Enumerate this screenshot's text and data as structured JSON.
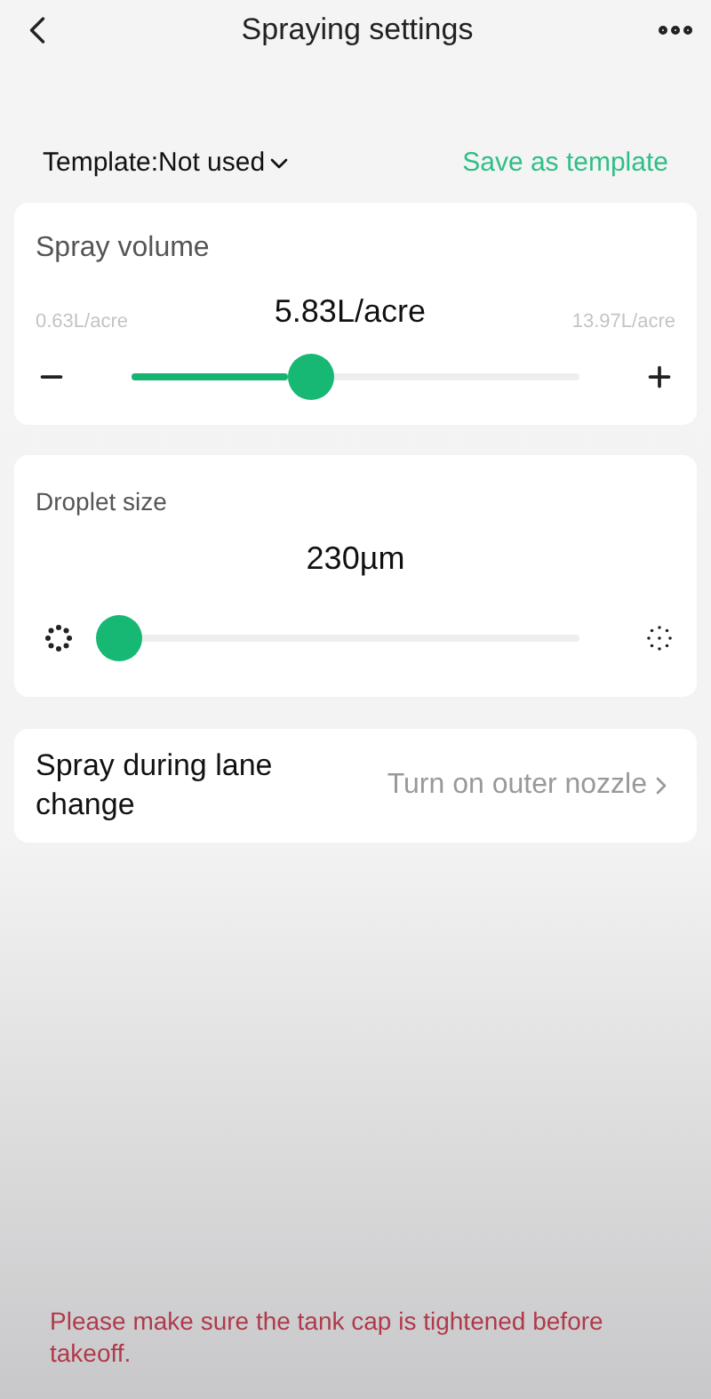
{
  "header": {
    "title": "Spraying settings"
  },
  "template": {
    "label": "Template:Not used",
    "save": "Save as template"
  },
  "spray_volume": {
    "title": "Spray volume",
    "min": "0.63L/acre",
    "value": "5.83L/acre",
    "max": "13.97L/acre",
    "level": 0.39
  },
  "droplet_size": {
    "title": "Droplet size",
    "value": "230µm",
    "level": 0
  },
  "lane_change": {
    "label": "Spray during lane change",
    "value": "Turn on outer nozzle"
  },
  "warning": "Please make sure the tank cap is tightened before takeoff."
}
